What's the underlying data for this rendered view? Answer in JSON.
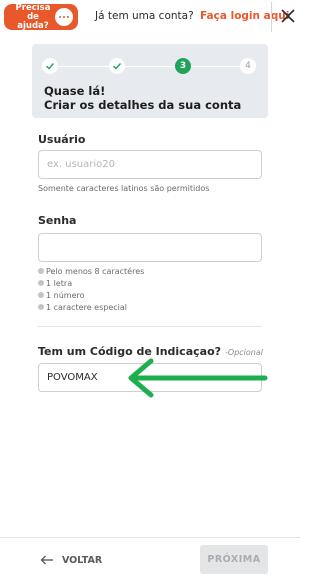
{
  "header": {
    "help_label": "Precisa de ajuda?",
    "login_prompt": "Já tem uma conta?",
    "login_link": "Faça login aqui"
  },
  "progress": {
    "current_step": 3,
    "total_steps": 4,
    "active_label": "3",
    "todo_label": "4",
    "title_line1": "Quase lá!",
    "title_line2": "Criar os detalhes da sua conta"
  },
  "form": {
    "username_label": "Usuário",
    "username_placeholder": "ex. usuario20",
    "username_value": "",
    "username_hint": "Somente caracteres latinos são permitidos",
    "password_label": "Senha",
    "password_value": "",
    "password_rules": [
      "Pelo menos 8 caractéres",
      "1 letra",
      "1 número",
      "1 caractere especial"
    ],
    "referral_label": "Tem um Código de Indicaçao?",
    "referral_optional": "-Opcional",
    "referral_value": "POVOMAX"
  },
  "footer": {
    "back_label": "VOLTAR",
    "next_label": "PRÓXIMA"
  },
  "colors": {
    "accent": "#e8582a",
    "step_active": "#20a35a",
    "annotation_arrow": "#1fae4f"
  }
}
